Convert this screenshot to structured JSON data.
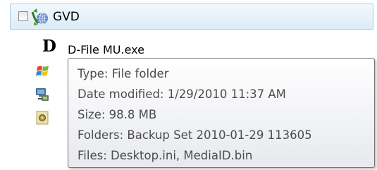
{
  "selected_row": {
    "label": "GVD",
    "checked": false
  },
  "items": [
    {
      "prefix": "D",
      "label": "D-File MU.exe",
      "icon": "d-letter-icon"
    },
    {
      "icon": "windows-flag-icon"
    },
    {
      "icon": "network-computer-icon"
    },
    {
      "icon": "setup-package-icon"
    }
  ],
  "tooltip": {
    "type_line": "Type: File folder",
    "date_line": "Date modified: 1/29/2010 11:37 AM",
    "size_line": "Size: 98.8 MB",
    "folders_line": "Folders: Backup Set 2010-01-29 113605",
    "files_line": "Files: Desktop.ini, MediaID.bin"
  },
  "colors": {
    "selection_border": "#a8cdec",
    "selection_fill": "#dcecf8",
    "tooltip_border": "#767676",
    "tooltip_text": "#4c4c4c"
  }
}
